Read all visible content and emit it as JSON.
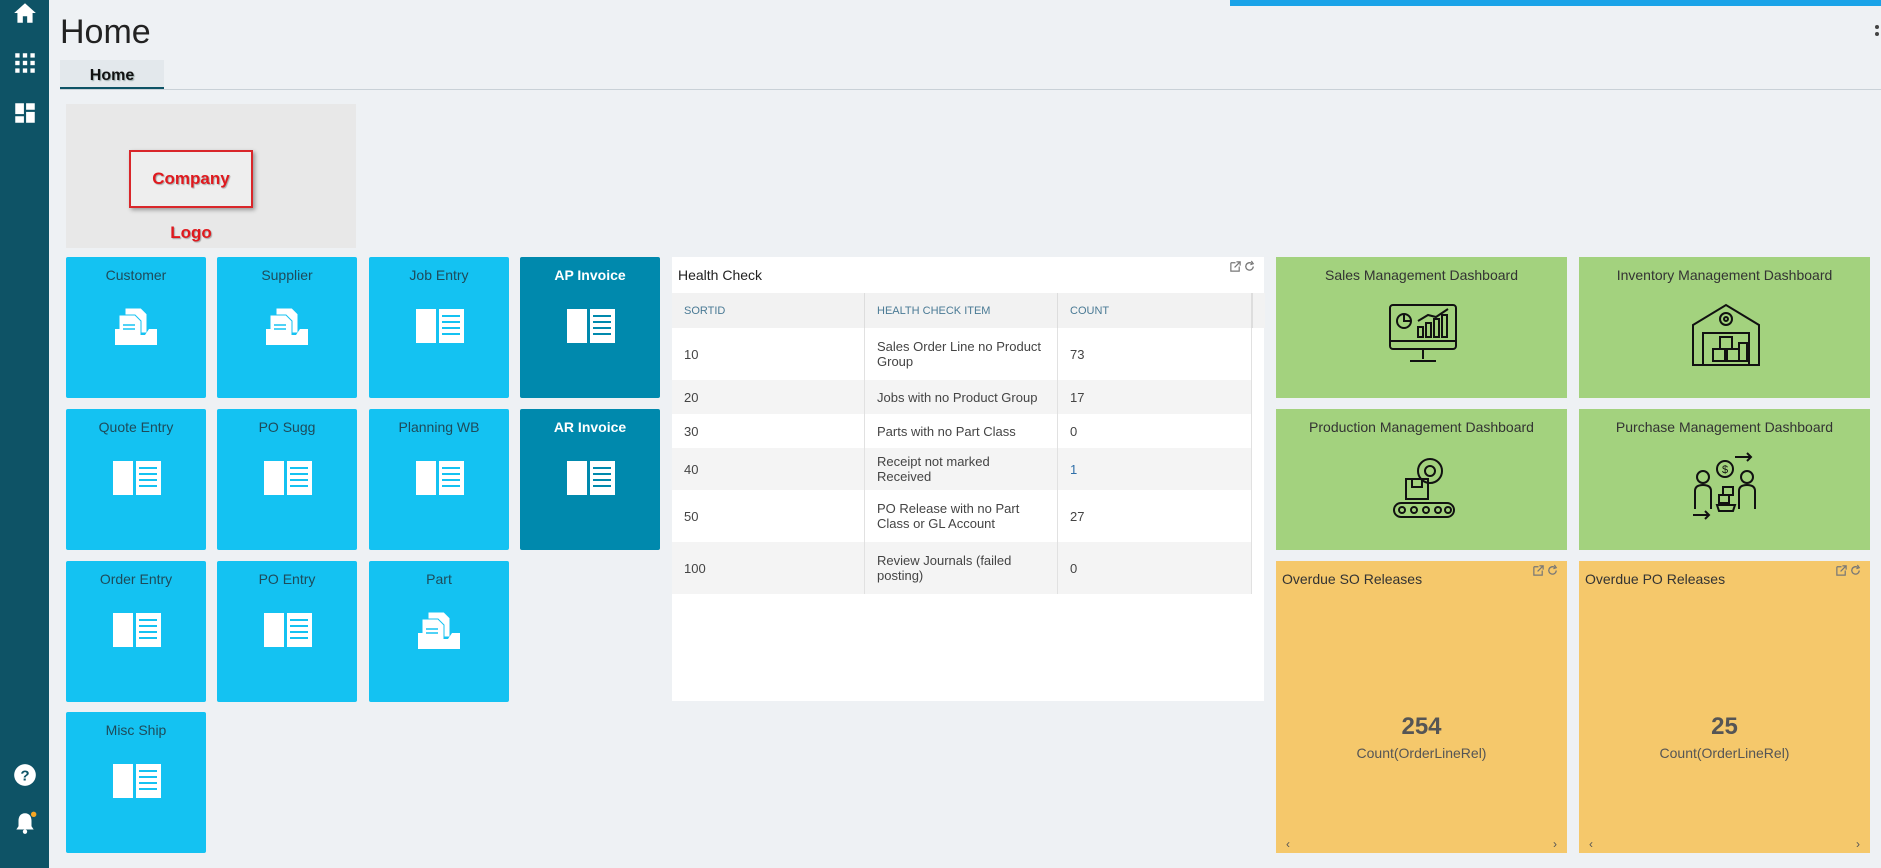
{
  "page": {
    "title": "Home",
    "tab": "Home"
  },
  "rail": {
    "icons": [
      "home-icon",
      "grid-apps-icon",
      "dashboard-icon",
      "help-icon",
      "bell-icon"
    ]
  },
  "logo": {
    "text": "Company Logo"
  },
  "tiles": [
    {
      "label": "Customer",
      "icon": "document-stack-icon",
      "style": "light"
    },
    {
      "label": "Supplier",
      "icon": "document-stack-icon",
      "style": "light"
    },
    {
      "label": "Job Entry",
      "icon": "form-icon",
      "style": "light"
    },
    {
      "label": "AP Invoice",
      "icon": "form-icon",
      "style": "dark"
    },
    {
      "label": "Quote Entry",
      "icon": "form-icon",
      "style": "light"
    },
    {
      "label": "PO Sugg",
      "icon": "form-icon",
      "style": "light"
    },
    {
      "label": "Planning WB",
      "icon": "form-icon",
      "style": "light"
    },
    {
      "label": "AR Invoice",
      "icon": "form-icon",
      "style": "dark"
    },
    {
      "label": "Order Entry",
      "icon": "form-icon",
      "style": "light"
    },
    {
      "label": "PO Entry",
      "icon": "form-icon",
      "style": "light"
    },
    {
      "label": "Part",
      "icon": "document-stack-icon",
      "style": "light"
    },
    {
      "label": "Misc Ship",
      "icon": "form-icon",
      "style": "light"
    }
  ],
  "health_check": {
    "title": "Health Check",
    "columns": [
      "SORTID",
      "HEALTH CHECK ITEM",
      "COUNT"
    ],
    "rows": [
      {
        "sortid": "10",
        "item": "Sales Order Line no Product Group",
        "count": "73"
      },
      {
        "sortid": "20",
        "item": "Jobs with no Product Group",
        "count": "17"
      },
      {
        "sortid": "30",
        "item": "Parts with no Part Class",
        "count": "0"
      },
      {
        "sortid": "40",
        "item": "Receipt not marked Received",
        "count": "1"
      },
      {
        "sortid": "50",
        "item": "PO Release with no Part Class or GL Account",
        "count": "27"
      },
      {
        "sortid": "100",
        "item": "Review Journals (failed posting)",
        "count": "0"
      }
    ]
  },
  "dashboards": [
    {
      "label": "Sales Management Dashboard",
      "icon": "monitor-chart-icon"
    },
    {
      "label": "Inventory Management Dashboard",
      "icon": "warehouse-icon"
    },
    {
      "label": "Production Management Dashboard",
      "icon": "conveyor-gear-icon"
    },
    {
      "label": "Purchase Management Dashboard",
      "icon": "purchase-exchange-icon"
    }
  ],
  "kpis": [
    {
      "title": "Overdue SO Releases",
      "value": "254",
      "sub": "Count(OrderLineRel)"
    },
    {
      "title": "Overdue PO Releases",
      "value": "25",
      "sub": "Count(OrderLineRel)"
    }
  ],
  "colors": {
    "rail": "#0e5366",
    "tile_light": "#14c2f2",
    "tile_dark": "#0089ad",
    "dash_green": "#a3d27e",
    "kpi_yellow": "#f5c86b",
    "accent_strip": "#1aa3e8"
  }
}
